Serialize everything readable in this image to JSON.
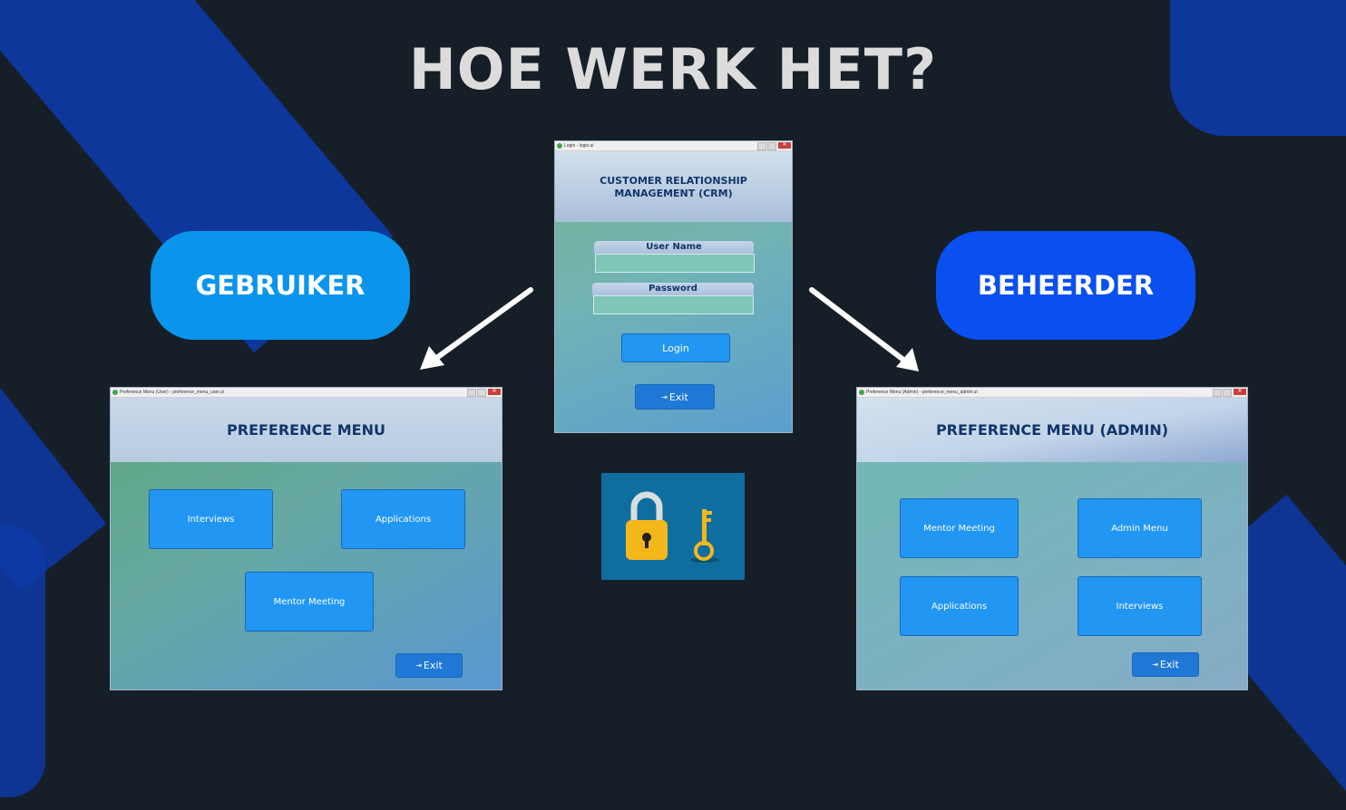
{
  "slide": {
    "title": "HOE WERK HET?",
    "user_pill": "GEBRUIKER",
    "admin_pill": "BEHEERDER",
    "colors": {
      "background": "#161f27",
      "user_pill": "#0a95ec",
      "admin_pill": "#0a4ff0",
      "accent_stripe": "#0d3aa8"
    }
  },
  "login_window": {
    "titlebar": "Login - login.ui",
    "header": "CUSTOMER RELATIONSHIP MANAGEMENT (CRM)",
    "username_label": "User Name",
    "password_label": "Password",
    "login_button": "Login",
    "exit_button": "Exit"
  },
  "user_window": {
    "titlebar": "Preference Menu (User) - preference_menu_user.ui",
    "header": "PREFERENCE MENU",
    "buttons": [
      "Interviews",
      "Applications",
      "Mentor Meeting"
    ],
    "exit_button": "Exit"
  },
  "admin_window": {
    "titlebar": "Preference Menu (Admin) - preference_menu_admin.ui",
    "header": "PREFERENCE MENU (ADMIN)",
    "buttons": [
      "Mentor Meeting",
      "Admin Menu",
      "Applications",
      "Interviews"
    ],
    "exit_button": "Exit"
  },
  "icons": {
    "lock": "padlock-icon",
    "key": "key-icon",
    "arrow_left": "arrow-down-left-icon",
    "arrow_right": "arrow-down-right-icon",
    "exit": "exit-icon"
  }
}
